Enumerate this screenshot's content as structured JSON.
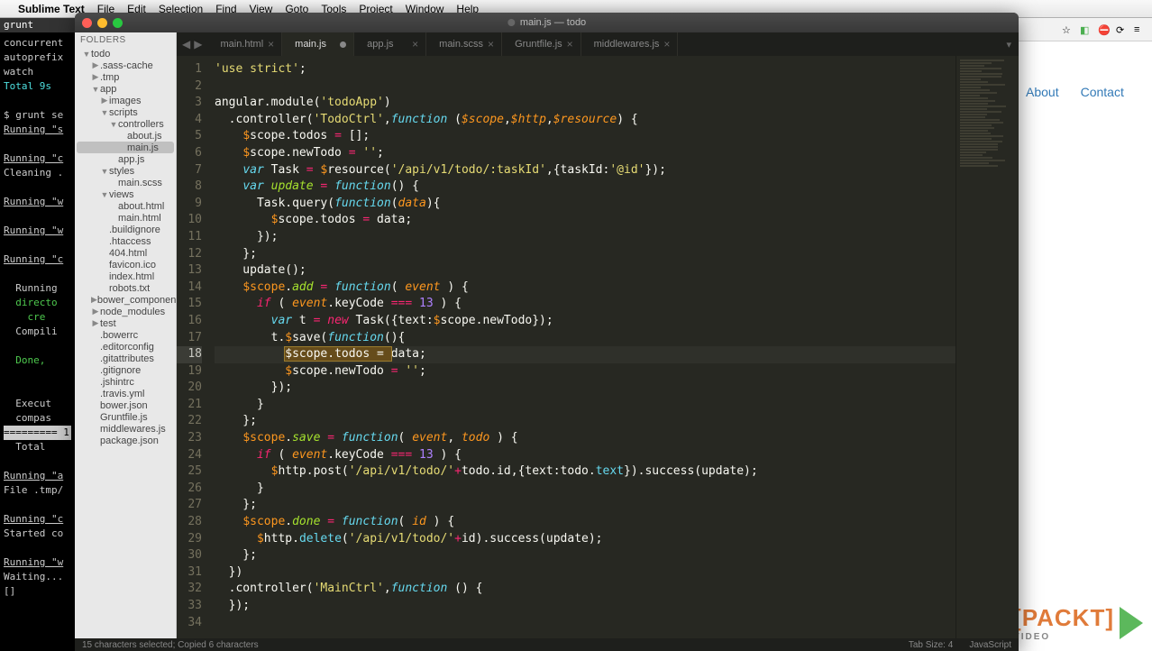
{
  "mac_menu": {
    "app": "Sublime Text",
    "items": [
      "File",
      "Edit",
      "Selection",
      "Find",
      "View",
      "Goto",
      "Tools",
      "Project",
      "Window",
      "Help"
    ]
  },
  "terminal": {
    "title": "grunt",
    "lines": [
      {
        "t": "concurrent",
        "c": ""
      },
      {
        "t": "autoprefix",
        "c": ""
      },
      {
        "t": "watch",
        "c": ""
      },
      {
        "t": "Total 9s",
        "c": "c"
      },
      {
        "t": " ",
        "c": ""
      },
      {
        "t": "$ grunt se",
        "c": ""
      },
      {
        "t": "Running \"s",
        "c": "under"
      },
      {
        "t": " ",
        "c": ""
      },
      {
        "t": "Running \"c",
        "c": "under"
      },
      {
        "t": "Cleaning .",
        "c": ""
      },
      {
        "t": " ",
        "c": ""
      },
      {
        "t": "Running \"w",
        "c": "under"
      },
      {
        "t": " ",
        "c": ""
      },
      {
        "t": "Running \"w",
        "c": "under"
      },
      {
        "t": " ",
        "c": ""
      },
      {
        "t": "Running \"c",
        "c": "under"
      },
      {
        "t": " ",
        "c": ""
      },
      {
        "t": "  Running",
        "c": ""
      },
      {
        "t": "  directo",
        "c": "g"
      },
      {
        "t": "    cre",
        "c": "g"
      },
      {
        "t": "  Compili",
        "c": ""
      },
      {
        "t": " ",
        "c": ""
      },
      {
        "t": "  Done, ",
        "c": "g"
      },
      {
        "t": " ",
        "c": ""
      },
      {
        "t": " ",
        "c": ""
      },
      {
        "t": "  Execut",
        "c": ""
      },
      {
        "t": "  compas",
        "c": ""
      },
      {
        "t": "========= 1",
        "c": "inv"
      },
      {
        "t": "  Total",
        "c": ""
      },
      {
        "t": " ",
        "c": ""
      },
      {
        "t": "Running \"a",
        "c": "under"
      },
      {
        "t": "File .tmp/",
        "c": ""
      },
      {
        "t": " ",
        "c": ""
      },
      {
        "t": "Running \"c",
        "c": "under"
      },
      {
        "t": "Started co",
        "c": ""
      },
      {
        "t": " ",
        "c": ""
      },
      {
        "t": "Running \"w",
        "c": "under"
      },
      {
        "t": "Waiting...",
        "c": ""
      },
      {
        "t": "[]",
        "c": ""
      }
    ]
  },
  "browser": {
    "nav": [
      "About",
      "Contact"
    ]
  },
  "packt": {
    "label": "[PACKT]",
    "sub": "VIDEO"
  },
  "sublime": {
    "window_title": "main.js — todo",
    "sidebar_header": "FOLDERS",
    "tree": [
      {
        "d": 1,
        "folder": true,
        "open": true,
        "label": "todo"
      },
      {
        "d": 2,
        "folder": true,
        "open": false,
        "label": ".sass-cache"
      },
      {
        "d": 2,
        "folder": true,
        "open": false,
        "label": ".tmp"
      },
      {
        "d": 2,
        "folder": true,
        "open": true,
        "label": "app"
      },
      {
        "d": 3,
        "folder": true,
        "open": false,
        "label": "images"
      },
      {
        "d": 3,
        "folder": true,
        "open": true,
        "label": "scripts"
      },
      {
        "d": 4,
        "folder": true,
        "open": true,
        "label": "controllers"
      },
      {
        "d": 5,
        "folder": false,
        "label": "about.js"
      },
      {
        "d": 5,
        "folder": false,
        "label": "main.js",
        "active": true
      },
      {
        "d": 4,
        "folder": false,
        "label": "app.js"
      },
      {
        "d": 3,
        "folder": true,
        "open": true,
        "label": "styles"
      },
      {
        "d": 4,
        "folder": false,
        "label": "main.scss"
      },
      {
        "d": 3,
        "folder": true,
        "open": true,
        "label": "views"
      },
      {
        "d": 4,
        "folder": false,
        "label": "about.html"
      },
      {
        "d": 4,
        "folder": false,
        "label": "main.html"
      },
      {
        "d": 3,
        "folder": false,
        "label": ".buildignore"
      },
      {
        "d": 3,
        "folder": false,
        "label": ".htaccess"
      },
      {
        "d": 3,
        "folder": false,
        "label": "404.html"
      },
      {
        "d": 3,
        "folder": false,
        "label": "favicon.ico"
      },
      {
        "d": 3,
        "folder": false,
        "label": "index.html"
      },
      {
        "d": 3,
        "folder": false,
        "label": "robots.txt"
      },
      {
        "d": 2,
        "folder": true,
        "open": false,
        "label": "bower_components"
      },
      {
        "d": 2,
        "folder": true,
        "open": false,
        "label": "node_modules"
      },
      {
        "d": 2,
        "folder": true,
        "open": false,
        "label": "test"
      },
      {
        "d": 2,
        "folder": false,
        "label": ".bowerrc"
      },
      {
        "d": 2,
        "folder": false,
        "label": ".editorconfig"
      },
      {
        "d": 2,
        "folder": false,
        "label": ".gitattributes"
      },
      {
        "d": 2,
        "folder": false,
        "label": ".gitignore"
      },
      {
        "d": 2,
        "folder": false,
        "label": ".jshintrc"
      },
      {
        "d": 2,
        "folder": false,
        "label": ".travis.yml"
      },
      {
        "d": 2,
        "folder": false,
        "label": "bower.json"
      },
      {
        "d": 2,
        "folder": false,
        "label": "Gruntfile.js"
      },
      {
        "d": 2,
        "folder": false,
        "label": "middlewares.js"
      },
      {
        "d": 2,
        "folder": false,
        "label": "package.json"
      }
    ],
    "tabs": [
      {
        "label": "main.html",
        "dirty": false
      },
      {
        "label": "main.js",
        "dirty": true,
        "active": true
      },
      {
        "label": "app.js",
        "dirty": false
      },
      {
        "label": "main.scss",
        "dirty": false
      },
      {
        "label": "Gruntfile.js",
        "dirty": false
      },
      {
        "label": "middlewares.js",
        "dirty": false
      }
    ],
    "status_left": "15 characters selected; Copied 6 characters",
    "status_tabsize": "Tab Size: 4",
    "status_lang": "JavaScript",
    "current_line": 18,
    "code_lines": [
      {
        "n": 1,
        "html": "<span class='k-str'>'use strict'</span>;"
      },
      {
        "n": 2,
        "html": ""
      },
      {
        "n": 3,
        "html": "angular.module(<span class='k-str'>'todoApp'</span>)"
      },
      {
        "n": 4,
        "html": "  .controller(<span class='k-str'>'TodoCtrl'</span>,<span class='k-kw2'>function</span> (<span class='k-prm'>$scope</span>,<span class='k-prm'>$http</span>,<span class='k-prm'>$resource</span>) {"
      },
      {
        "n": 5,
        "html": "    <span class='k-this'>$</span>scope.todos <span class='k-op'>=</span> [];"
      },
      {
        "n": 6,
        "html": "    <span class='k-this'>$</span>scope.newTodo <span class='k-op'>=</span> <span class='k-str'>''</span>;"
      },
      {
        "n": 7,
        "html": "    <span class='k-kw2'>var</span> Task <span class='k-op'>=</span> <span class='k-this'>$</span>resource(<span class='k-str'>'/api/v1/todo/:taskId'</span>,{taskId:<span class='k-str'>'@id'</span>});"
      },
      {
        "n": 8,
        "html": "    <span class='k-kw2'>var</span> <span class='k-fn'>update</span> <span class='k-op'>=</span> <span class='k-kw2'>function</span>() {"
      },
      {
        "n": 9,
        "html": "      Task.query(<span class='k-kw2'>function</span>(<span class='k-prm'>data</span>){"
      },
      {
        "n": 10,
        "html": "        <span class='k-this'>$</span>scope.todos <span class='k-op'>=</span> data;"
      },
      {
        "n": 11,
        "html": "      });"
      },
      {
        "n": 12,
        "html": "    };"
      },
      {
        "n": 13,
        "html": "    update();"
      },
      {
        "n": 14,
        "html": "    <span class='k-this'>$scope</span>.<span class='k-fn'>add</span> <span class='k-op'>=</span> <span class='k-kw2'>function</span>( <span class='k-prm'>event</span> ) {"
      },
      {
        "n": 15,
        "html": "      <span class='k-kw'>if</span> ( <span class='k-prm'>event</span>.keyCode <span class='k-op'>===</span> <span class='k-num'>13</span> ) {"
      },
      {
        "n": 16,
        "html": "        <span class='k-kw2'>var</span> t <span class='k-op'>=</span> <span class='k-kw'>new</span> Task({text:<span class='k-this'>$</span>scope.newTodo});"
      },
      {
        "n": 17,
        "html": "        t.<span class='k-this'>$</span>save(<span class='k-kw2'>function</span>(){"
      },
      {
        "n": 18,
        "html": "          <span class='find-hl'>$scope.todos = </span>data;",
        "cur": true
      },
      {
        "n": 19,
        "html": "          <span class='k-this'>$</span>scope.newTodo <span class='k-op'>=</span> <span class='k-str'>''</span>;"
      },
      {
        "n": 20,
        "html": "        });"
      },
      {
        "n": 21,
        "html": "      }"
      },
      {
        "n": 22,
        "html": "    };"
      },
      {
        "n": 23,
        "html": "    <span class='k-this'>$scope</span>.<span class='k-fn'>save</span> <span class='k-op'>=</span> <span class='k-kw2'>function</span>( <span class='k-prm'>event</span>, <span class='k-prm'>todo</span> ) {"
      },
      {
        "n": 24,
        "html": "      <span class='k-kw'>if</span> ( <span class='k-prm'>event</span>.keyCode <span class='k-op'>===</span> <span class='k-num'>13</span> ) {"
      },
      {
        "n": 25,
        "html": "        <span class='k-this'>$</span>http.post(<span class='k-str'>'/api/v1/todo/'</span><span class='k-op'>+</span>todo.id,{text:todo.<span class='k-call'>text</span>}).success(update);"
      },
      {
        "n": 26,
        "html": "      }"
      },
      {
        "n": 27,
        "html": "    };"
      },
      {
        "n": 28,
        "html": "    <span class='k-this'>$scope</span>.<span class='k-fn'>done</span> <span class='k-op'>=</span> <span class='k-kw2'>function</span>( <span class='k-prm'>id</span> ) {"
      },
      {
        "n": 29,
        "html": "      <span class='k-this'>$</span>http.<span class='k-call'>delete</span>(<span class='k-str'>'/api/v1/todo/'</span><span class='k-op'>+</span>id).success(update);"
      },
      {
        "n": 30,
        "html": "    };"
      },
      {
        "n": 31,
        "html": "  })"
      },
      {
        "n": 32,
        "html": "  .controller(<span class='k-str'>'MainCtrl'</span>,<span class='k-kw2'>function</span> () {"
      },
      {
        "n": 33,
        "html": "  });"
      },
      {
        "n": 34,
        "html": ""
      }
    ]
  }
}
